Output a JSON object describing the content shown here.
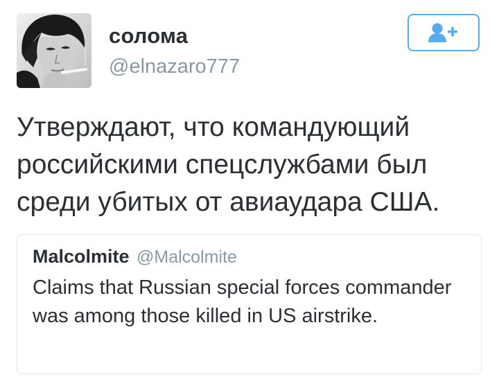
{
  "tweet": {
    "author": {
      "display_name": "солома",
      "username": "@elnazaro777",
      "avatar": "profile-photo"
    },
    "follow_button": {
      "icon": "follow-user-plus-icon",
      "accent_color": "#55acee"
    },
    "text": "Утверждают, что командующий\nроссийскими спецслужбами был\nсреди убитых от авиаудара США."
  },
  "quoted_tweet": {
    "display_name": "Malcolmite",
    "username": "@Malcolmite",
    "text": "Claims that Russian special forces commander was among those killed in US airstrike."
  },
  "colors": {
    "primary_text": "#292f33",
    "secondary_text": "#8899a6",
    "border": "#e1e8ed",
    "accent": "#55acee"
  }
}
